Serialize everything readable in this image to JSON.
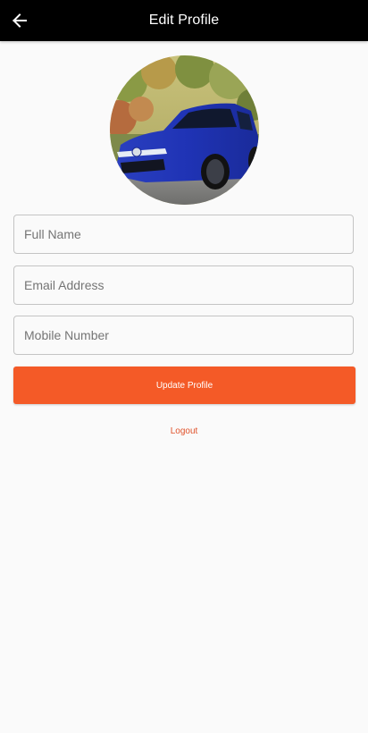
{
  "appbar": {
    "title": "Edit Profile",
    "back_icon": "arrow-left-icon"
  },
  "profile": {
    "avatar_image": "blue hatchback car photo"
  },
  "form": {
    "full_name": {
      "value": "",
      "placeholder": "Full Name"
    },
    "email": {
      "value": "",
      "placeholder": "Email Address"
    },
    "mobile": {
      "value": "",
      "placeholder": "Mobile Number"
    },
    "update_label": "Update Profile",
    "logout_label": "Logout"
  },
  "colors": {
    "appbar_bg": "#000000",
    "accent": "#f45a27",
    "background": "#fafafa"
  }
}
